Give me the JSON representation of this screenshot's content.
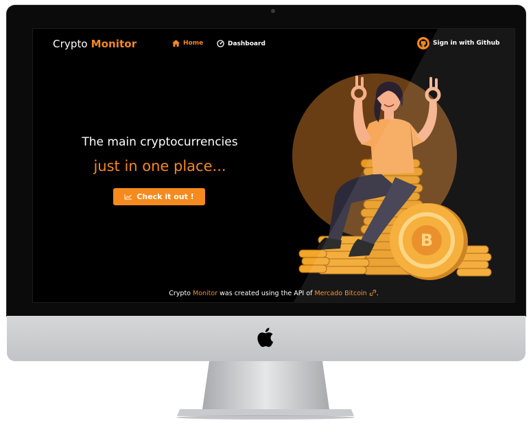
{
  "brand": {
    "prefix": "Crypto",
    "accent": "Monitor"
  },
  "nav": {
    "home_label": "Home",
    "dashboard_label": "Dashboard",
    "github_label": "Sign in with Github"
  },
  "hero": {
    "title": "The main cryptocurrencies",
    "subtitle": "just in one place...",
    "cta_label": "Check it out !"
  },
  "footer": {
    "part1": "Crypto ",
    "part2": "Monitor",
    "part3": " was created using the API of ",
    "part4": "Mercado Bitcoin",
    "part5": "."
  },
  "icons": {
    "home": "home-icon",
    "dashboard": "dashboard-icon",
    "github": "github-icon",
    "chart": "chart-line-icon",
    "link": "link-icon",
    "apple": "apple-logo-icon"
  },
  "colors": {
    "accent": "#f58a1f",
    "background": "#000000",
    "text": "#ffffff"
  }
}
